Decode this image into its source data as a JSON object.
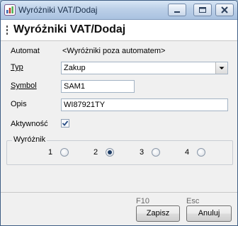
{
  "window": {
    "title": "Wyróżniki VAT/Dodaj"
  },
  "header": {
    "title": "Wyróżniki VAT/Dodaj"
  },
  "form": {
    "automat": {
      "label": "Automat",
      "value": "<Wyróżniki poza automatem>"
    },
    "typ": {
      "label": "Typ",
      "value": "Zakup"
    },
    "symbol": {
      "label": "Symbol",
      "value": "SAM1"
    },
    "opis": {
      "label": "Opis",
      "value": "WI87921TY"
    },
    "aktywnosc": {
      "label": "Aktywność",
      "checked": true
    }
  },
  "wyroznik": {
    "title": "Wyróżnik",
    "options": [
      "1",
      "2",
      "3",
      "4"
    ],
    "selected": "2"
  },
  "footer": {
    "save": {
      "label": "Zapisz",
      "hotkey": "F10"
    },
    "cancel": {
      "label": "Anuluj",
      "hotkey": "Esc"
    }
  },
  "colors": {
    "titlebar": "#bcd0e8",
    "dialog": "#f0f0f0",
    "radio_selected": "#1f3e66"
  },
  "icons": [
    "app-icon",
    "minimize-icon",
    "maximize-icon",
    "close-icon",
    "dropdown-arrow-icon",
    "checkmark-icon"
  ]
}
